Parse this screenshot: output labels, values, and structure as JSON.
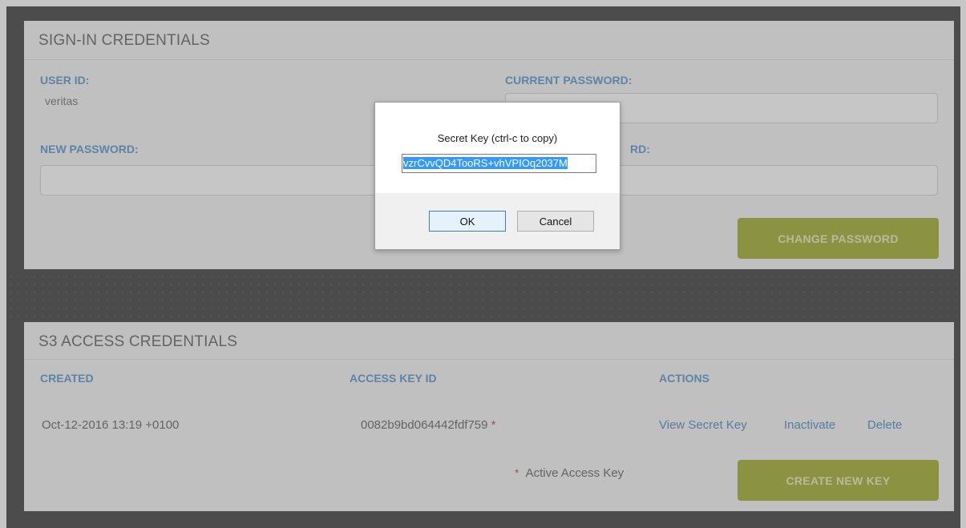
{
  "signin": {
    "title": "SIGN-IN CREDENTIALS",
    "user_id_label": "USER ID:",
    "user_id_value": "veritas",
    "current_password_label": "CURRENT PASSWORD:",
    "new_password_label": "NEW PASSWORD:",
    "confirm_password_label": "RD:",
    "change_password_button": "CHANGE PASSWORD"
  },
  "s3": {
    "title": "S3 ACCESS CREDENTIALS",
    "columns": [
      "CREATED",
      "ACCESS KEY ID",
      "ACTIONS"
    ],
    "rows": [
      {
        "created": "Oct-12-2016 13:19 +0100",
        "access_key_id": "0082b9bd064442fdf759",
        "active_marker": "*",
        "actions": [
          "View Secret Key",
          "Inactivate",
          "Delete"
        ]
      }
    ],
    "legend_marker": "*",
    "legend_text": "Active Access Key",
    "create_key_button": "CREATE NEW KEY"
  },
  "dialog": {
    "prompt": "Secret Key (ctrl-c to copy)",
    "secret_value": "vzrCvvQD4TooRS+vhVPIOq2037M",
    "ok_label": "OK",
    "cancel_label": "Cancel"
  },
  "colors": {
    "accent_blue": "#4b8dc6",
    "button_green": "#9aa81c",
    "asterisk_red": "#c0392b",
    "selection_blue": "#3399ff"
  }
}
